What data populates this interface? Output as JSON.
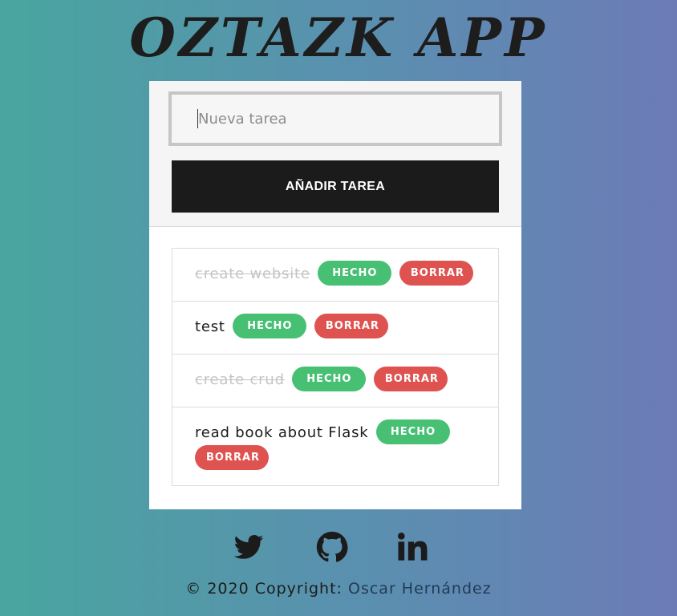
{
  "header": {
    "title": "OZTAZK APP"
  },
  "form": {
    "input_placeholder": "Nueva tarea",
    "input_value": "",
    "add_button_label": "AÑADIR TAREA"
  },
  "tasks": [
    {
      "text": "create website",
      "done": true,
      "done_label": "HECHO",
      "delete_label": "BORRAR"
    },
    {
      "text": "test",
      "done": false,
      "done_label": "HECHO",
      "delete_label": "BORRAR"
    },
    {
      "text": "create crud",
      "done": true,
      "done_label": "HECHO",
      "delete_label": "BORRAR"
    },
    {
      "text": "read book about Flask",
      "done": false,
      "done_label": "HECHO",
      "delete_label": "BORRAR"
    }
  ],
  "social": [
    {
      "icon": "twitter-icon"
    },
    {
      "icon": "github-icon"
    },
    {
      "icon": "linkedin-icon"
    }
  ],
  "footer": {
    "copyright_prefix": "© 2020 Copyright: ",
    "author": "Oscar Hernández"
  },
  "colors": {
    "done_button": "#48c073",
    "delete_button": "#de5350",
    "add_button": "#1b1b1b",
    "completed_text": "#c4c4c4"
  }
}
